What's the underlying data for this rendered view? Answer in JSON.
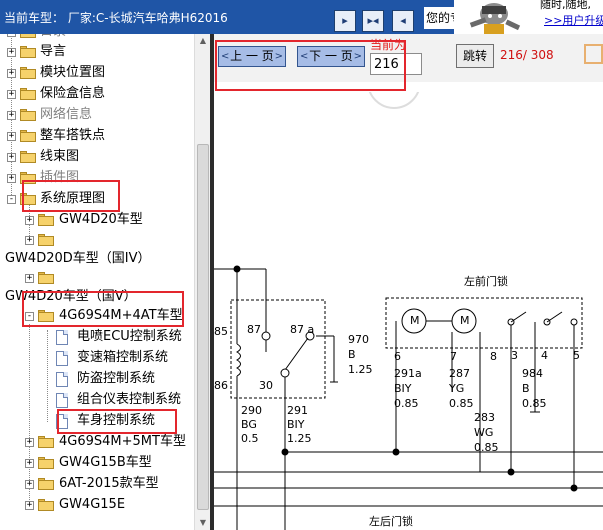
{
  "header": {
    "model_text": "当前车型：  厂家:C-长城汽车哈弗H62016",
    "nav_first_label": "▸",
    "nav_fit_label": "▸◂",
    "nav_last_label": "◂",
    "welcome_text": "您的专",
    "support_line1": "随时,随地,",
    "support_link": ">>用户升级"
  },
  "tree": {
    "items": [
      {
        "label": "目录",
        "expander": "+",
        "icon": "folder-icon"
      },
      {
        "label": "导言",
        "expander": "+",
        "icon": "folder-icon"
      },
      {
        "label": "模块位置图",
        "expander": "+",
        "icon": "folder-icon"
      },
      {
        "label": "保险盒信息",
        "expander": "+",
        "icon": "folder-icon"
      },
      {
        "label": "网络信息",
        "expander": "+",
        "icon": "folder-icon"
      },
      {
        "label": "整车搭铁点",
        "expander": "+",
        "icon": "folder-icon"
      },
      {
        "label": "线束图",
        "expander": "+",
        "icon": "folder-icon"
      },
      {
        "label": "插件图",
        "expander": "+",
        "icon": "folder-icon"
      },
      {
        "label": "系统原理图",
        "expander": "-",
        "icon": "folder-icon"
      },
      {
        "label": "GW4D20车型",
        "expander": "+",
        "icon": "folder-icon"
      },
      {
        "label": "",
        "expander": "+",
        "icon": "folder-icon"
      },
      {
        "label": "GW4D20D车型（国IV）",
        "expander": "",
        "icon": ""
      },
      {
        "label": "",
        "expander": "+",
        "icon": "folder-icon"
      },
      {
        "label": "GW4D20车型（国V）",
        "expander": "",
        "icon": ""
      },
      {
        "label": "4G69S4M+4AT车型",
        "expander": "-",
        "icon": "folder-icon"
      },
      {
        "label": "电喷ECU控制系统",
        "expander": "",
        "icon": "document-icon"
      },
      {
        "label": "变速箱控制系统",
        "expander": "",
        "icon": "document-icon"
      },
      {
        "label": "防盗控制系统",
        "expander": "",
        "icon": "document-icon"
      },
      {
        "label": "组合仪表控制系统",
        "expander": "",
        "icon": "document-icon"
      },
      {
        "label": "车身控制系统",
        "expander": "",
        "icon": "document-icon"
      },
      {
        "label": "4G69S4M+5MT车型",
        "expander": "+",
        "icon": "folder-icon"
      },
      {
        "label": "GW4G15B车型",
        "expander": "+",
        "icon": "folder-icon"
      },
      {
        "label": "6AT-2015款车型",
        "expander": "+",
        "icon": "folder-icon"
      },
      {
        "label": "GW4G15E",
        "expander": "+",
        "icon": "folder-icon"
      }
    ]
  },
  "toolbar": {
    "prev_label": "上 一 页",
    "next_label": "下 一 页",
    "current_label": "当前为",
    "page_value": "216",
    "jump_label": "跳转",
    "page_count": "216/ 308"
  },
  "diagram": {
    "front_door_lock_title": "左前门锁",
    "rear_door_lock_title": "左后门锁",
    "relay_pins": [
      "85",
      "87",
      "87 a",
      "86",
      "30"
    ],
    "motor_label": "M",
    "connector_pins": [
      "6",
      "7",
      "8",
      "3",
      "4",
      "5"
    ],
    "wires": [
      {
        "circuit": "290",
        "color": "BG",
        "size": "0.5"
      },
      {
        "circuit": "291",
        "color": "BIY",
        "size": "1.25"
      },
      {
        "circuit": "970",
        "color": "B",
        "size": "1.25"
      },
      {
        "circuit": "291a",
        "color": "BIY",
        "size": "0.85"
      },
      {
        "circuit": "287",
        "color": "YG",
        "size": "0.85"
      },
      {
        "circuit": "283",
        "color": "WG",
        "size": "0.85"
      },
      {
        "circuit": "984",
        "color": "B",
        "size": "0.85"
      }
    ]
  }
}
